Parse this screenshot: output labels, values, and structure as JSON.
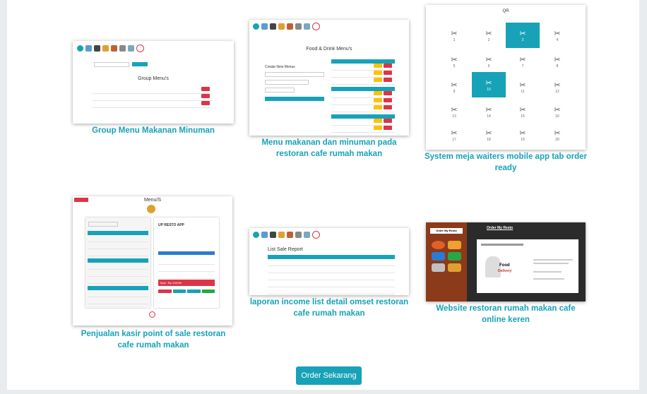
{
  "cards": [
    {
      "caption": "Group Menu Makanan Minuman"
    },
    {
      "caption": "Menu makanan dan minuman pada restoran cafe rumah makan"
    },
    {
      "caption": "System meja waiters mobile app tab order ready"
    },
    {
      "caption": "Penjualan kasir point of sale restoran cafe rumah makan"
    },
    {
      "caption": "laporan income list detail omset restoran cafe rumah makan"
    },
    {
      "caption": "Website restoran rumah makan cafe online keren"
    }
  ],
  "thumb1": {
    "title": "Group Menu's"
  },
  "thumb2": {
    "title": "Food & Drink Menu's",
    "form_title": "Create New Menus"
  },
  "thumb3": {
    "title": "QR"
  },
  "thumb4": {
    "title": "Menu/S",
    "app_name": "UP RESTO APP",
    "total": "Total : Rp 110000"
  },
  "thumb5": {
    "title": "List Sale Report"
  },
  "thumb6": {
    "brand": "Order My Resto",
    "heading": "Order My Resto",
    "logo_line1": "Food",
    "logo_line2": "Delivery"
  },
  "order_button": {
    "label": "Order Sekarang"
  },
  "colors": {
    "accent": "#17a2b8",
    "danger": "#dc3545",
    "warning": "#ffc107"
  }
}
